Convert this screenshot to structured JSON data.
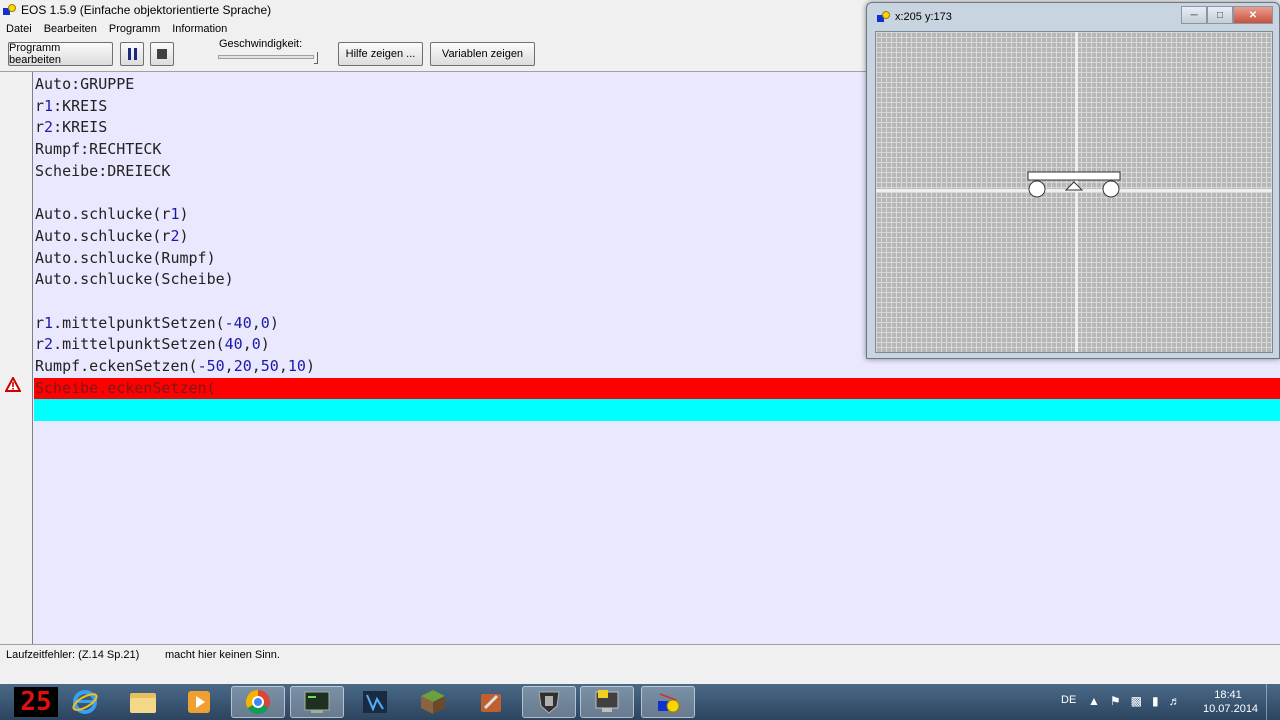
{
  "window": {
    "title": "EOS 1.5.9 (Einfache objektorientierte Sprache)"
  },
  "menu": [
    "Datei",
    "Bearbeiten",
    "Programm",
    "Information"
  ],
  "toolbar": {
    "edit_program": "Programm bearbeiten",
    "speed_label": "Geschwindigkeit:",
    "speed_value_fraction": 1.0,
    "show_help": "Hilfe zeigen ...",
    "show_variables": "Variablen zeigen"
  },
  "editor": {
    "lines": [
      "Auto:GRUPPE",
      "r1:KREIS",
      "r2:KREIS",
      "Rumpf:RECHTECK",
      "Scheibe:DREIECK",
      "",
      "Auto.schlucke(r1)",
      "Auto.schlucke(r2)",
      "Auto.schlucke(Rumpf)",
      "Auto.schlucke(Scheibe)",
      "",
      "r1.mittelpunktSetzen(-40,0)",
      "r2.mittelpunktSetzen(40,0)",
      "Rumpf.eckenSetzen(-50,20,50,10)",
      "Scheibe.eckenSetzen(",
      ""
    ],
    "error_line": 14,
    "current_line": 15
  },
  "status": {
    "error": "Laufzeitfehler: (Z.14 Sp.21)",
    "message": "macht hier keinen Sinn."
  },
  "canvas": {
    "coords": "x:205 y:173"
  },
  "taskbar": {
    "counter": "25",
    "apps": [
      "internet-explorer",
      "file-explorer",
      "media-player",
      "chrome",
      "terminal",
      "game-a",
      "minecraft",
      "app-tools",
      "world-of-tanks",
      "game-b",
      "eos"
    ],
    "lang": "DE",
    "time": "18:41",
    "date": "10.07.2014"
  }
}
